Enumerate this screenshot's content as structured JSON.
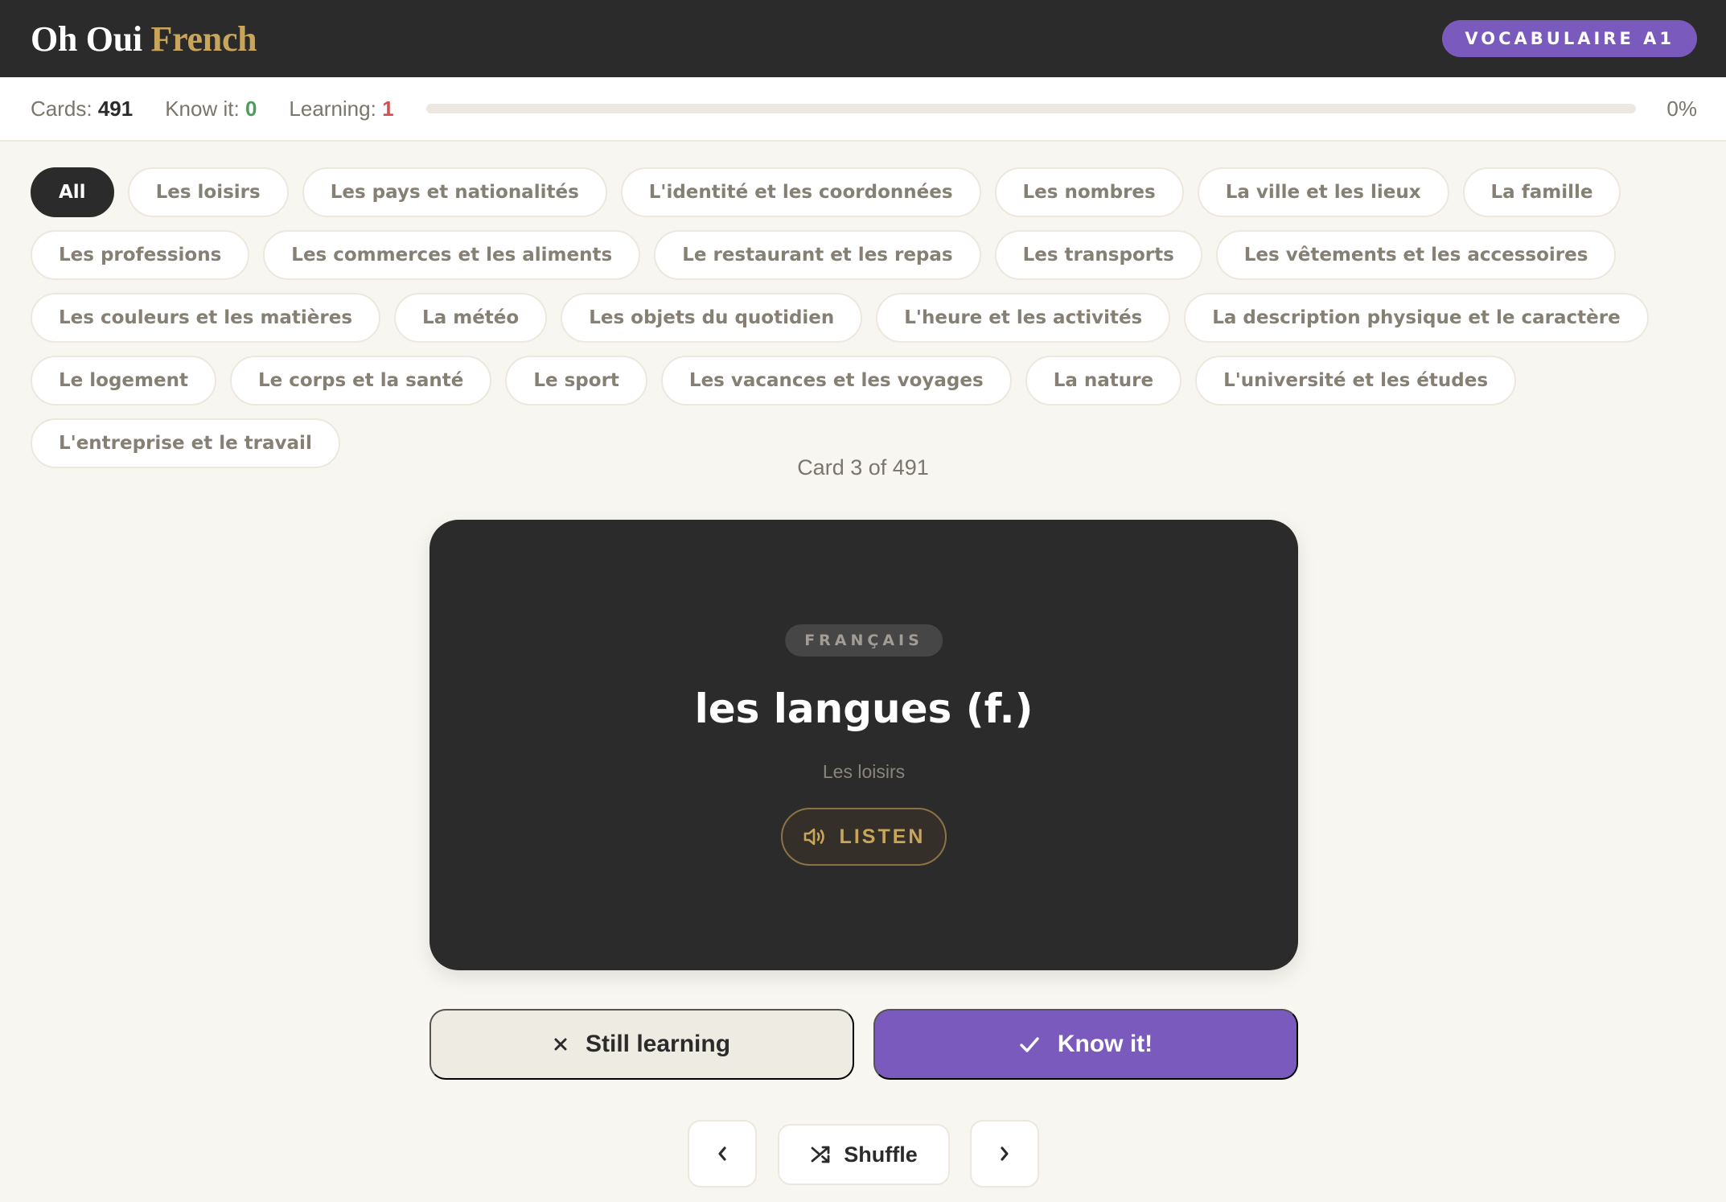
{
  "header": {
    "brand_word1": "Oh Oui",
    "brand_word2": "French",
    "level_badge": "VOCABULAIRE A1"
  },
  "stats": {
    "cards_label": "Cards:",
    "cards_value": "491",
    "known_label": "Know it:",
    "known_value": "0",
    "learning_label": "Learning:",
    "learning_value": "1",
    "progress_fraction": 0,
    "progress_text": "0%"
  },
  "categories": [
    "All",
    "Les loisirs",
    "Les pays et nationalités",
    "L'identité et les coordonnées",
    "Les nombres",
    "La ville et les lieux",
    "La famille",
    "Les professions",
    "Les commerces et les aliments",
    "Le restaurant et les repas",
    "Les transports",
    "Les vêtements et les accessoires",
    "Les couleurs et les matières",
    "La météo",
    "Les objets du quotidien",
    "L'heure et les activités",
    "La description physique et le caractère",
    "Le logement",
    "Le corps et la santé",
    "Le sport",
    "Les vacances et les voyages",
    "La nature",
    "L'université et les études",
    "L'entreprise et le travail"
  ],
  "active_category": "All",
  "counter": "Card 3 of 491",
  "card": {
    "language_tag": "FRANÇAIS",
    "term": "les langues (f.)",
    "category": "Les loisirs",
    "listen_label": "LISTEN"
  },
  "actions": {
    "still_learning_label": "Still learning",
    "know_it_label": "Know it!"
  },
  "nav": {
    "shuffle_label": "Shuffle"
  },
  "colors": {
    "accent_purple": "#7a5bbd",
    "brand_gold": "#c9a55c",
    "dark": "#2b2b2b",
    "known_green": "#4f9a5c",
    "learning_red": "#d44f4f"
  },
  "icons": {
    "listen": "speaker-icon",
    "still_learning": "x-icon",
    "know_it": "check-icon",
    "prev": "chevron-left-icon",
    "shuffle": "shuffle-icon",
    "next": "chevron-right-icon"
  }
}
